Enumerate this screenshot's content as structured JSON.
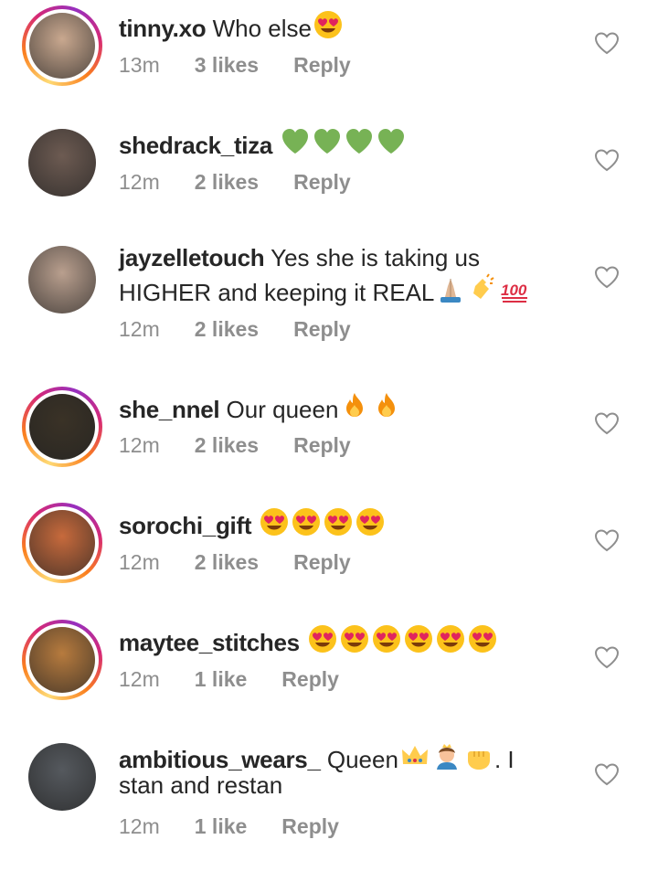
{
  "comments": [
    {
      "username": "tinny.xo",
      "text": "Who else",
      "emoji": [
        "heart-eyes"
      ],
      "time": "13m",
      "likes": "3 likes",
      "reply": "Reply",
      "ring": true,
      "avatar": "#c9a88f"
    },
    {
      "username": "shedrack_tiza",
      "text": "",
      "emoji": [
        "green-heart",
        "green-heart",
        "green-heart",
        "green-heart"
      ],
      "time": "12m",
      "likes": "2 likes",
      "reply": "Reply",
      "ring": false,
      "avatar": "#6d5b52"
    },
    {
      "username": "jayzelletouch",
      "text": "Yes she is taking us",
      "text2": "HIGHER and keeping it REAL",
      "emoji2": [
        "pray",
        "clap",
        "hundred"
      ],
      "time": "12m",
      "likes": "2 likes",
      "reply": "Reply",
      "ring": false,
      "avatar": "#b99f8e"
    },
    {
      "username": "she_nnel",
      "text": "Our queen",
      "emoji": [
        "fire",
        "fire"
      ],
      "time": "12m",
      "likes": "2 likes",
      "reply": "Reply",
      "ring": true,
      "avatar": "#3a3226"
    },
    {
      "username": "sorochi_gift",
      "text": "",
      "emoji": [
        "heart-eyes",
        "heart-eyes",
        "heart-eyes",
        "heart-eyes"
      ],
      "time": "12m",
      "likes": "2 likes",
      "reply": "Reply",
      "ring": true,
      "avatar": "#c76a3c"
    },
    {
      "username": "maytee_stitches",
      "text": "",
      "emoji": [
        "heart-eyes",
        "heart-eyes",
        "heart-eyes",
        "heart-eyes",
        "heart-eyes",
        "heart-eyes"
      ],
      "time": "12m",
      "likes": "1 like",
      "reply": "Reply",
      "ring": true,
      "avatar": "#b77b3e"
    },
    {
      "username": "ambitious_wears_",
      "text": "Queen",
      "emoji": [
        "crown",
        "princess",
        "fist"
      ],
      "text_after": ". I",
      "text2": "stan and restan",
      "time": "12m",
      "likes": "1 like",
      "reply": "Reply",
      "ring": false,
      "avatar": "#55595e"
    }
  ],
  "colors": {
    "text": "#262626",
    "meta": "#8e8e8e",
    "heart_stroke": "#8e8e8e"
  }
}
